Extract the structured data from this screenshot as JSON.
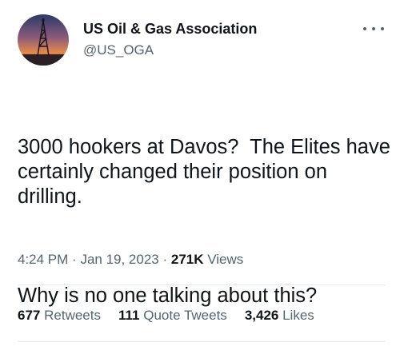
{
  "author": {
    "name": "US Oil & Gas Association",
    "handle": "@US_OGA",
    "avatar_icon": "oil-rig-sunset-avatar"
  },
  "tweet": {
    "lines": [
      "3000 hookers at Davos?  The Elites have certainly changed their position on drilling.",
      "Why is no one talking about this?"
    ]
  },
  "meta": {
    "time": "4:24 PM",
    "date": "Jan 19, 2023",
    "views_count": "271K",
    "views_label": "Views"
  },
  "stats": [
    {
      "count": "677",
      "label": "Retweets"
    },
    {
      "count": "111",
      "label": "Quote Tweets"
    },
    {
      "count": "3,426",
      "label": "Likes"
    }
  ],
  "colors": {
    "text": "#0f1419",
    "secondary": "#536471",
    "divider": "#e6e9eb"
  }
}
